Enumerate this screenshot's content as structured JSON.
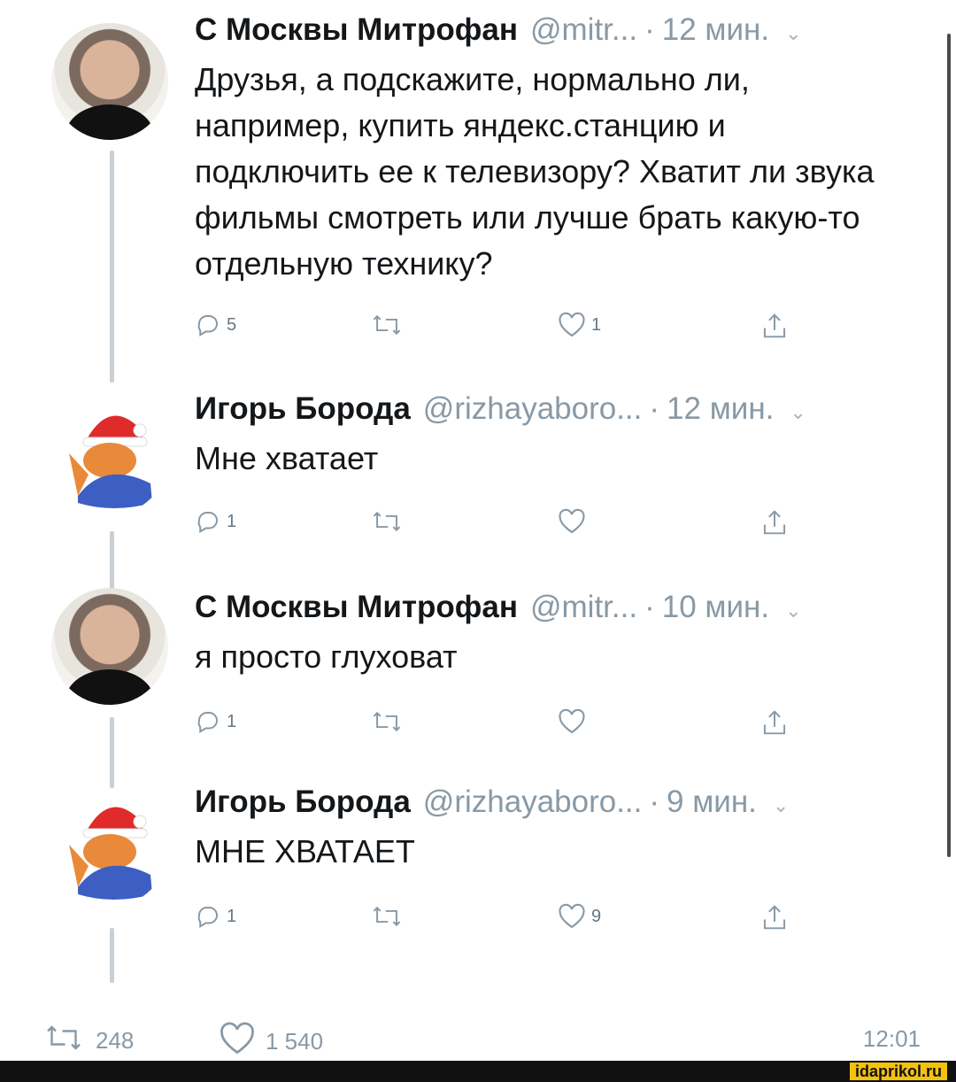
{
  "tweets": [
    {
      "name": "С Москвы Митрофан",
      "handle": "@mitr...",
      "dot": "·",
      "time": "12 мин.",
      "text": "Друзья, а подскажите, нормально ли, например, купить яндекс.станцию и подключить ее к телевизору? Хватит ли звука фильмы смотреть или лучше брать какую-то отдельную технику?",
      "replies": "5",
      "retweets": "",
      "likes": "1"
    },
    {
      "name": "Игорь Борода",
      "handle": "@rizhayaboro...",
      "dot": "·",
      "time": "12 мин.",
      "text": "Мне хватает",
      "replies": "1",
      "retweets": "",
      "likes": ""
    },
    {
      "name": "С Москвы Митрофан",
      "handle": "@mitr...",
      "dot": "·",
      "time": "10 мин.",
      "text": "я просто глуховат",
      "replies": "1",
      "retweets": "",
      "likes": ""
    },
    {
      "name": "Игорь Борода",
      "handle": "@rizhayaboro...",
      "dot": "·",
      "time": "9 мин.",
      "text": "МНЕ ХВАТАЕТ",
      "replies": "1",
      "retweets": "",
      "likes": "9"
    }
  ],
  "footer": {
    "retweets": "248",
    "likes": "1 540",
    "clock": "12:01"
  },
  "watermark": "idaprikol.ru",
  "icons": {
    "reply": "reply-icon",
    "retweet": "retweet-icon",
    "like": "heart-icon",
    "share": "share-icon",
    "chevron": "chevron-down-icon"
  },
  "colors": {
    "text": "#14171a",
    "muted": "#8899a6",
    "thread_line": "#c8d0d6",
    "watermark_bg": "#f4c20d"
  }
}
